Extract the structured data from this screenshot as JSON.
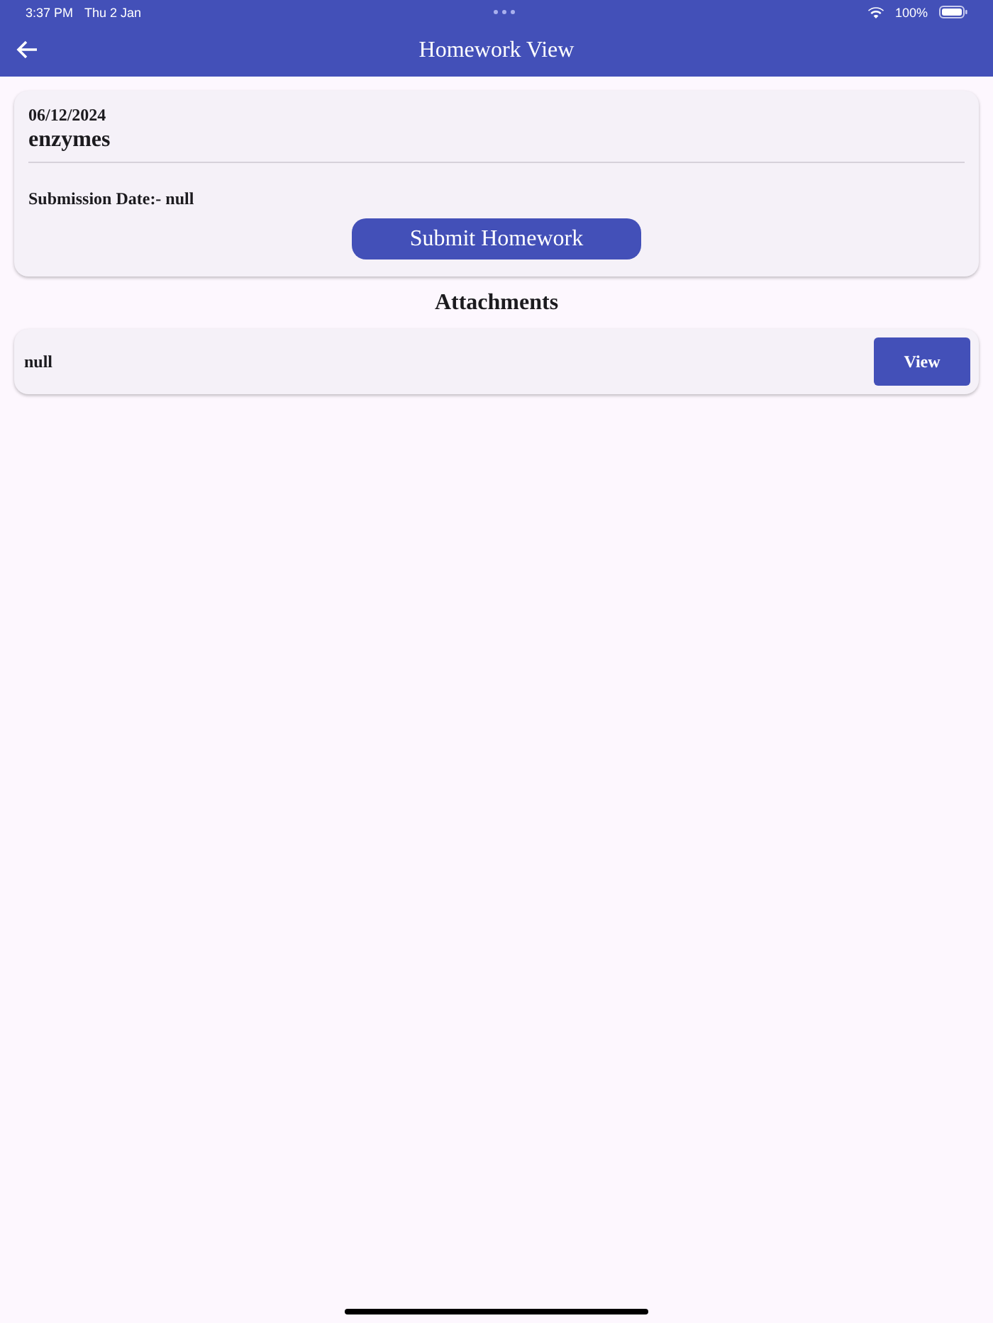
{
  "status_bar": {
    "time": "3:37 PM",
    "date": "Thu 2 Jan",
    "battery": "100%"
  },
  "app_bar": {
    "title": "Homework View"
  },
  "homework": {
    "date": "06/12/2024",
    "title": "enzymes",
    "submission": "Submission Date:- null",
    "button": "Submit Homework"
  },
  "attachments": {
    "heading": "Attachments",
    "items": [
      {
        "name": "null",
        "button": "View"
      }
    ]
  }
}
